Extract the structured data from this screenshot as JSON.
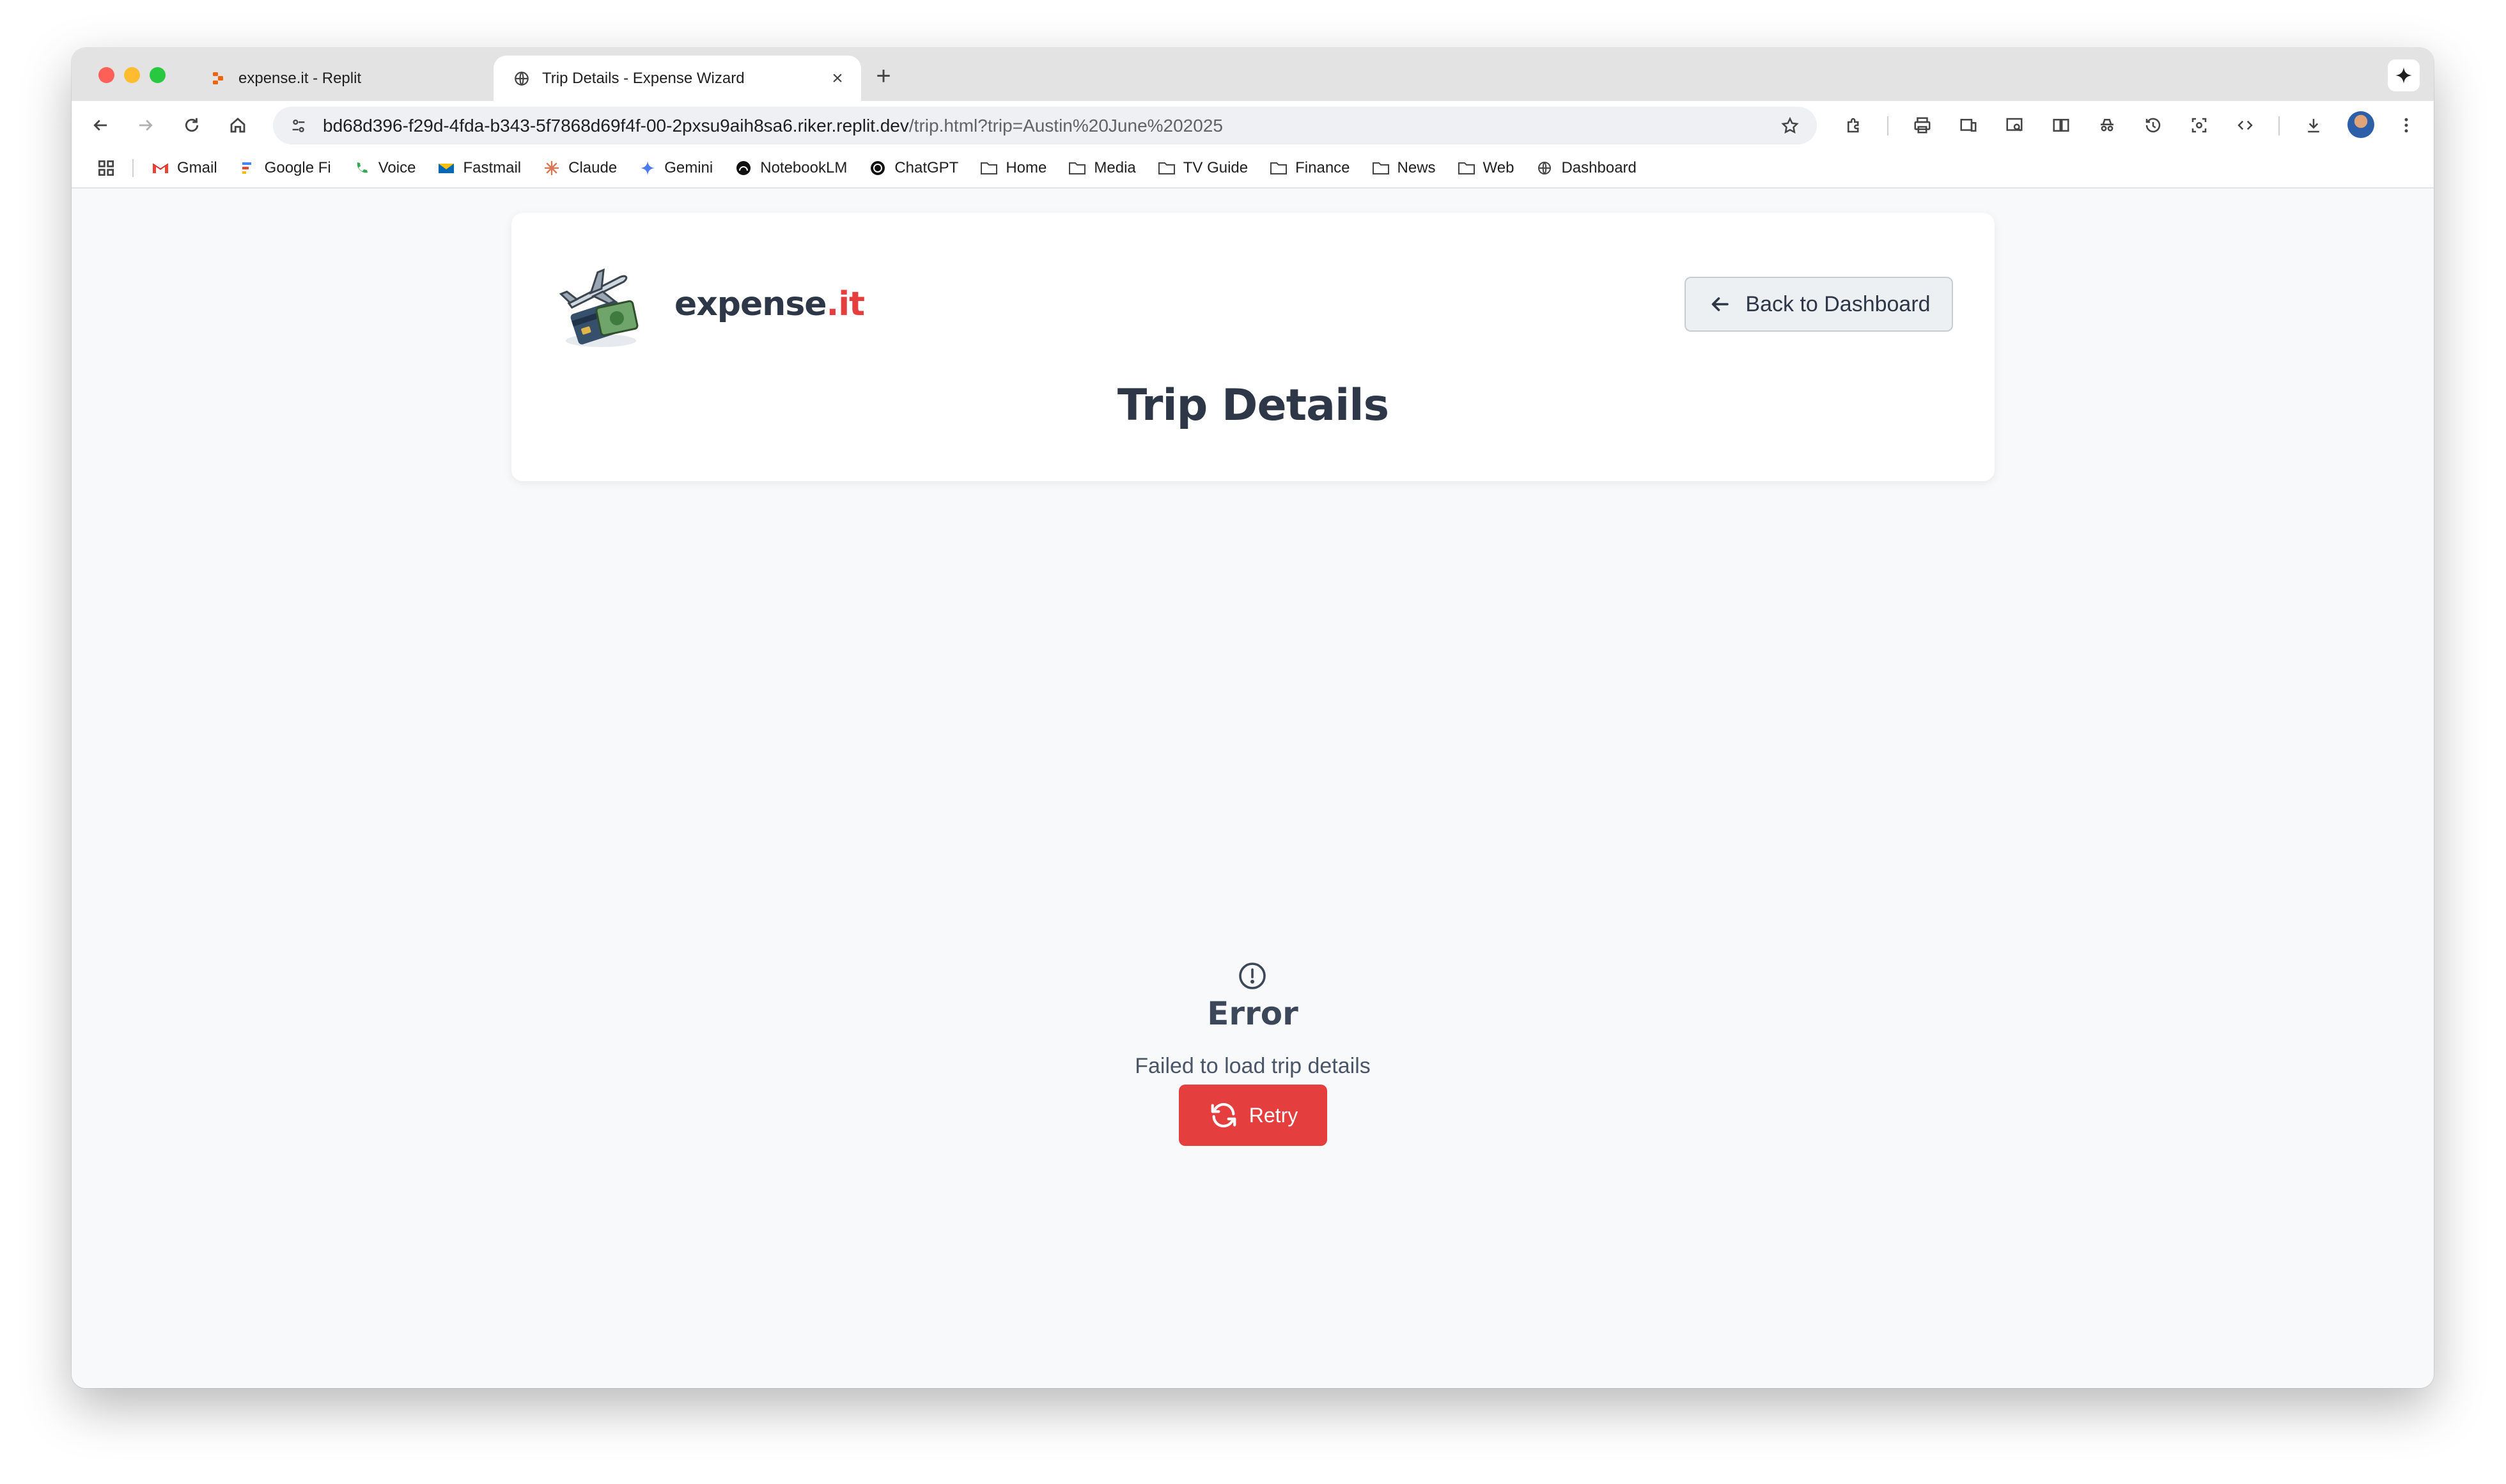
{
  "browser": {
    "tabs": [
      {
        "title": "expense.it - Replit",
        "active": false
      },
      {
        "title": "Trip Details - Expense Wizard",
        "active": true
      }
    ],
    "close_glyph": "×",
    "new_tab_glyph": "+",
    "url_host": "bd68d396-f29d-4fda-b343-5f7868d69f4f-00-2pxsu9aih8sa6.riker.replit.dev",
    "url_path": "/trip.html?trip=Austin%20June%202025",
    "bookmarks": [
      {
        "label": "Gmail",
        "icon": "gmail-icon"
      },
      {
        "label": "Google Fi",
        "icon": "google-fi-icon"
      },
      {
        "label": "Voice",
        "icon": "voice-icon"
      },
      {
        "label": "Fastmail",
        "icon": "fastmail-icon"
      },
      {
        "label": "Claude",
        "icon": "claude-icon"
      },
      {
        "label": "Gemini",
        "icon": "gemini-icon"
      },
      {
        "label": "NotebookLM",
        "icon": "notebooklm-icon"
      },
      {
        "label": "ChatGPT",
        "icon": "chatgpt-icon"
      },
      {
        "label": "Home",
        "icon": "folder-icon"
      },
      {
        "label": "Media",
        "icon": "folder-icon"
      },
      {
        "label": "TV Guide",
        "icon": "folder-icon"
      },
      {
        "label": "Finance",
        "icon": "folder-icon"
      },
      {
        "label": "News",
        "icon": "folder-icon"
      },
      {
        "label": "Web",
        "icon": "folder-icon"
      },
      {
        "label": "Dashboard",
        "icon": "globe-icon"
      }
    ]
  },
  "app": {
    "brand_main": "expense",
    "brand_accent": ".it",
    "back_button": "Back to Dashboard",
    "page_title": "Trip Details",
    "error": {
      "heading": "Error",
      "message": "Failed to load trip details",
      "retry_label": "Retry"
    }
  },
  "colors": {
    "accent": "#e53e3e",
    "heading": "#2d3748",
    "page_bg": "#f7f9fb"
  }
}
